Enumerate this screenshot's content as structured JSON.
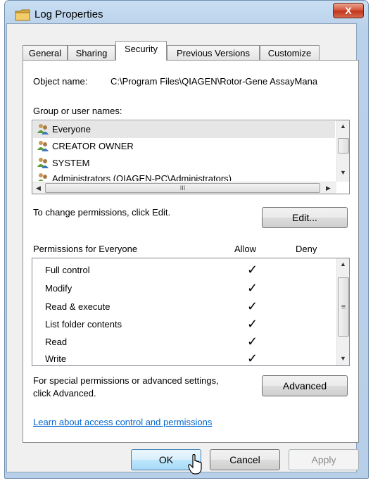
{
  "window": {
    "title": "Log Properties",
    "close_glyph": "X"
  },
  "tabs": [
    {
      "label": "General"
    },
    {
      "label": "Sharing"
    },
    {
      "label": "Security"
    },
    {
      "label": "Previous Versions"
    },
    {
      "label": "Customize"
    }
  ],
  "security": {
    "object_name_label": "Object name:",
    "object_name_value": "C:\\Program Files\\QIAGEN\\Rotor-Gene AssayMana",
    "group_label": "Group or user names:",
    "users": [
      {
        "name": "Everyone"
      },
      {
        "name": "CREATOR OWNER"
      },
      {
        "name": "SYSTEM"
      },
      {
        "name": "Administrators (QIAGEN-PC\\Administrators)"
      }
    ],
    "change_text": "To change permissions, click Edit.",
    "edit_button": "Edit...",
    "permissions_header": "Permissions for Everyone",
    "allow_header": "Allow",
    "deny_header": "Deny",
    "permissions": [
      {
        "name": "Full control",
        "allow": true,
        "deny": false
      },
      {
        "name": "Modify",
        "allow": true,
        "deny": false
      },
      {
        "name": "Read & execute",
        "allow": true,
        "deny": false
      },
      {
        "name": "List folder contents",
        "allow": true,
        "deny": false
      },
      {
        "name": "Read",
        "allow": true,
        "deny": false
      },
      {
        "name": "Write",
        "allow": true,
        "deny": false
      }
    ],
    "check_glyph": "✓",
    "special_text_line1": "For special permissions or advanced settings,",
    "special_text_line2": "click Advanced.",
    "advanced_button": "Advanced",
    "learn_link": "Learn about access control and permissions",
    "hscroll_grip": "III",
    "vscroll_grip": "≡"
  },
  "footer": {
    "ok": "OK",
    "cancel": "Cancel",
    "apply": "Apply"
  },
  "icons": {
    "title": "folder-icon",
    "user": "user-group-icon",
    "cursor": "mouse-pointer-icon"
  }
}
